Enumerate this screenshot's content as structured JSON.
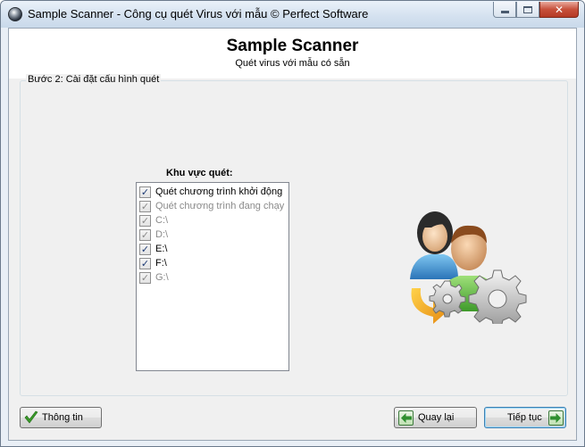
{
  "window": {
    "title": "Sample Scanner - Công cụ quét Virus với mẫu © Perfect Software"
  },
  "header": {
    "title": "Sample Scanner",
    "subtitle": "Quét virus với mẫu có sẵn"
  },
  "step": {
    "label": "Bước 2: Cài đặt cấu hình quét"
  },
  "scan_area": {
    "label": "Khu vực quét:",
    "items": [
      {
        "label": "Quét chương trình khởi động",
        "checked": true,
        "enabled": true
      },
      {
        "label": "Quét chương trình đang chạy",
        "checked": true,
        "enabled": false
      },
      {
        "label": "C:\\",
        "checked": true,
        "enabled": false
      },
      {
        "label": "D:\\",
        "checked": true,
        "enabled": false
      },
      {
        "label": "E:\\",
        "checked": true,
        "enabled": true
      },
      {
        "label": "F:\\",
        "checked": true,
        "enabled": true
      },
      {
        "label": "G:\\",
        "checked": true,
        "enabled": false
      }
    ]
  },
  "buttons": {
    "info": "Thông tin",
    "back": "Quay lại",
    "next": "Tiếp tục"
  },
  "icons": {
    "app": "app-sphere-icon",
    "illustration": "users-gear-icon",
    "info": "checkmark-icon",
    "back": "arrow-left-icon",
    "next": "arrow-right-icon"
  },
  "colors": {
    "title_bar": "#d5e2f0",
    "close_button": "#c7503b",
    "dialog_bg": "#f0f0f0",
    "header_bg": "#ffffff",
    "primary_button_border": "#3c7fb1",
    "check_green": "#3a9a2a"
  }
}
